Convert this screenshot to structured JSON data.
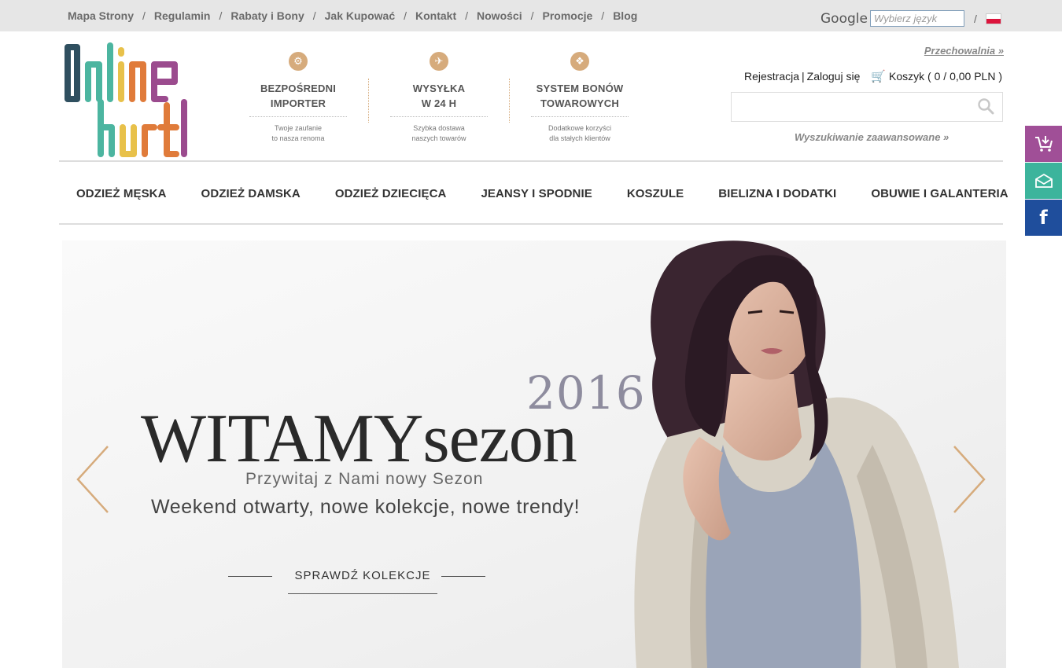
{
  "topbar": {
    "links": [
      "Mapa Strony",
      "Regulamin",
      "Rabaty i Bony",
      "Jak Kupować",
      "Kontakt",
      "Nowości",
      "Promocje",
      "Blog"
    ],
    "separator": "/",
    "google_word": "Google",
    "language_placeholder": "Wybierz język",
    "lang_separator": "/",
    "flag_icon": "poland-flag-icon"
  },
  "logo": {
    "text": "Online hurt",
    "colors": [
      "#2f4f5f",
      "#4cb5a0",
      "#e8c14a",
      "#e07b3a",
      "#9b4b8e"
    ]
  },
  "features": [
    {
      "icon": "handshake-icon",
      "title_line1": "BEZPOŚREDNI",
      "title_line2": "IMPORTER",
      "desc_line1": "Twoje zaufanie",
      "desc_line2": "to nasza renoma"
    },
    {
      "icon": "truck-icon",
      "title_line1": "WYSYŁKA",
      "title_line2": "W 24 H",
      "desc_line1": "Szybka dostawa",
      "desc_line2": "naszych towarów"
    },
    {
      "icon": "tag-icon",
      "title_line1": "SYSTEM BONÓW",
      "title_line2": "TOWAROWYCH",
      "desc_line1": "Dodatkowe korzyści",
      "desc_line2": "dla stałych klientów"
    }
  ],
  "header": {
    "przechowalnia": "Przechowalnia »",
    "register": "Rejestracja",
    "account_sep": "|",
    "login": "Zaloguj się",
    "cart": "Koszyk ( 0 / 0,00 PLN )",
    "search_icon": "search-icon",
    "advanced_search": "Wyszukiwanie zaawansowane »"
  },
  "nav": [
    "ODZIEŻ MĘSKA",
    "ODZIEŻ DAMSKA",
    "ODZIEŻ DZIECIĘCA",
    "JEANSY I SPODNIE",
    "KOSZULE",
    "BIELIZNA I DODATKI",
    "OBUWIE I GALANTERIA"
  ],
  "side": {
    "cart_icon": "cart-plus-icon",
    "mail_icon": "mail-icon",
    "fb": "f"
  },
  "hero": {
    "year": "2016",
    "title": "WITAMYsezon",
    "subtitle": "Przywitaj z Nami nowy Sezon",
    "tagline": "Weekend otwarty, nowe kolekcje, nowe trendy!",
    "cta": "SPRAWDŹ KOLEKCJE",
    "arrow_color": "#d6ab7c"
  }
}
